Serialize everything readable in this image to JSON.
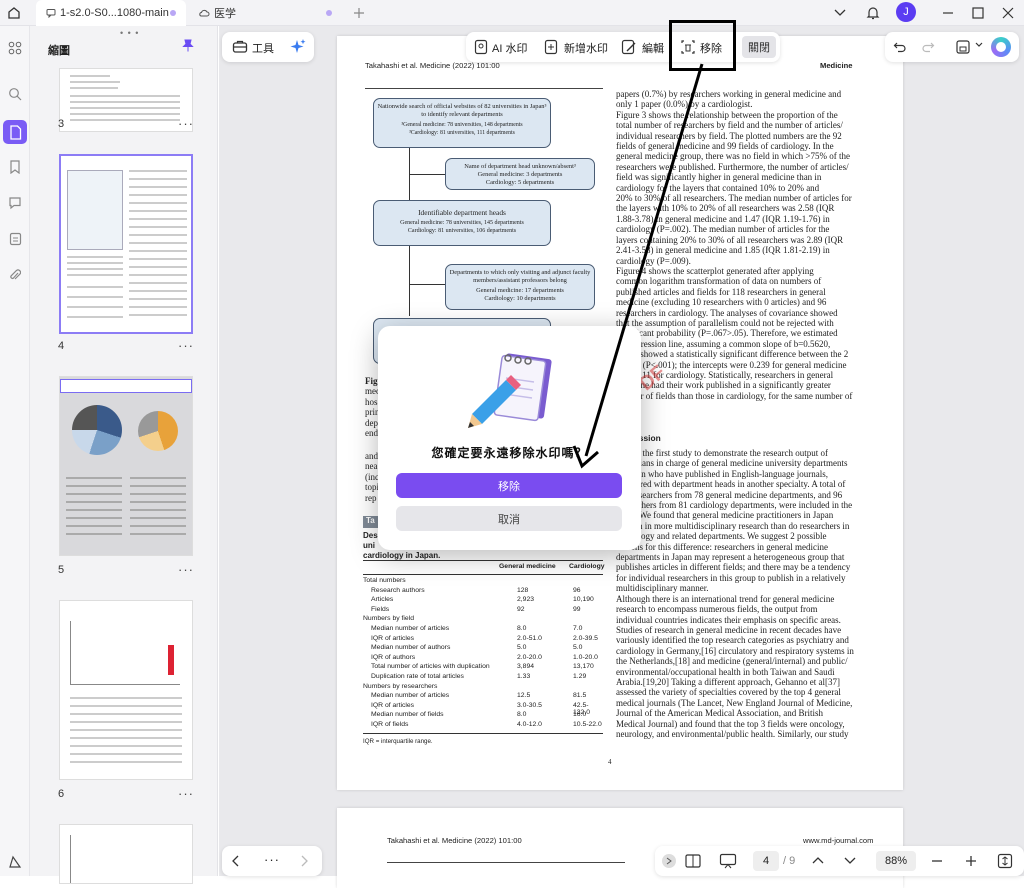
{
  "titlebar": {
    "tab1": "1-s2.0-S0...1080-main",
    "tab2": "医学",
    "avatar": "J"
  },
  "toolbar": {
    "tools_label": "工具",
    "ai_watermark": "AI 水印",
    "add_watermark": "新增水印",
    "edit": "編輯",
    "remove": "移除",
    "close": "關閉"
  },
  "sidebar": {
    "title": "縮圖",
    "pages": [
      {
        "num": "3",
        "more": "···"
      },
      {
        "num": "4",
        "more": "···"
      },
      {
        "num": "5",
        "more": "···"
      },
      {
        "num": "6",
        "more": "···"
      }
    ]
  },
  "page": {
    "running_head": "Takahashi et al. Medicine (2022) 101:00",
    "journal": "Medicine",
    "page_number": "4",
    "flow": {
      "box1": "Nationwide search of official websites of 82 universities in Japan³ to identify relevant departments",
      "box1_sub1": "³General medicine: 78 universities, 148 departments",
      "box1_sub2": "³Cardiology: 81 universities, 111 departments",
      "box2": "Name of department head unknown/absent³",
      "box2_sub1": "General medicine: 3 departments",
      "box2_sub2": "Cardiology: 5 departments",
      "box3": "Identifiable department heads",
      "box3_sub1": "General medicine: 78 universities, 145 departments",
      "box3_sub2": "Cardiology: 81 universities, 106 departments",
      "box4": "Departments to which only visiting and adjunct faculty members/assistant professors belong",
      "box4_sub1": "General medicine: 17 departments",
      "box4_sub2": "Cardiology: 10 departments"
    },
    "left_fragments": [
      "Figu",
      "med",
      "hos",
      "prin",
      "dep",
      "end"
    ],
    "left_fragments2": [
      "and",
      "nea",
      "(inc",
      "topi",
      "rep"
    ],
    "table_label": "Ta",
    "table_title1": "Des",
    "table_title2": "uni",
    "table_title3": "cardiology in Japan.",
    "table": {
      "headers": [
        "General medicine",
        "Cardiology"
      ],
      "rows": [
        [
          "Total numbers",
          "",
          ""
        ],
        [
          "Research authors",
          "128",
          "96"
        ],
        [
          "Articles",
          "2,923",
          "10,190"
        ],
        [
          "Fields",
          "92",
          "99"
        ],
        [
          "Numbers by field",
          "",
          ""
        ],
        [
          "Median number of articles",
          "8.0",
          "7.0"
        ],
        [
          "IQR of articles",
          "2.0-51.0",
          "2.0-39.5"
        ],
        [
          "Median number of authors",
          "5.0",
          "5.0"
        ],
        [
          "IQR of authors",
          "2.0-20.0",
          "1.0-20.0"
        ],
        [
          "Total number of articles with duplication",
          "3,894",
          "13,170"
        ],
        [
          "Duplication rate of total articles",
          "1.33",
          "1.29"
        ],
        [
          "Numbers by researchers",
          "",
          ""
        ],
        [
          "Median number of articles",
          "12.5",
          "81.5"
        ],
        [
          "IQR of articles",
          "3.0-30.5",
          "42.5-132.0"
        ],
        [
          "Median number of fields",
          "8.0",
          "16.0"
        ],
        [
          "IQR of fields",
          "4.0-12.0",
          "10.5-22.0"
        ]
      ],
      "footnote": "IQR = interquartile range."
    },
    "right_col": [
      "papers (0.7%) by researchers working in general medicine and",
      "only 1 paper (0.0%) by a cardiologist.",
      "Figure 3 shows the relationship between the proportion of the",
      "total number of researchers by field and the number of articles/",
      "individual researchers by field. The plotted numbers are the 92",
      "fields of general medicine and 99 fields of cardiology. In the",
      "general medicine group, there was no field in which >75% of the",
      "researchers were published. Furthermore, the number of articles/",
      "field was significantly higher in general medicine than in",
      "cardiology for the layers that contained 10% to 20% and",
      "20% to 30% of all researchers. The median number of articles for",
      "the layers with 10% to 20% of all researchers was 2.58 (IQR",
      "1.88-3.78) in general medicine and 1.47 (IQR 1.19-1.76) in",
      "cardiology (P=.002). The median number of articles for the",
      "layers containing 20% to 30% of all researchers was 2.89 (IQR",
      "2.41-3.58) in general medicine and 1.85 (IQR 1.81-2.19) in",
      "cardiology (P=.009).",
      "Figure 4 shows the scatterplot generated after applying",
      "common logarithm transformation of data on numbers of",
      "published articles and fields for 118 researchers in general",
      "medicine (excluding 10 researchers with 0 articles) and 96",
      "researchers in cardiology. The analyses of covariance showed",
      "that the assumption of parallelism could not be rejected with",
      "significant probability (P=.067>.05). Therefore, we estimated",
      "the regression line, assuming a common slope of b=0.5620,",
      "which showed a statistically significant difference between the 2",
      "groups (P<.001); the intercepts were 0.239 for general medicine",
      "and 0.111 for cardiology. Statistically, researchers in general",
      "medicine had their work published in a significantly greater",
      "number of fields than those in cardiology, for the same number of"
    ],
    "discussion_heading": "Discussion",
    "discussion": [
      "This is the first study to demonstrate the research output of",
      "physicians in charge of general medicine university departments",
      "in Japan who have published in English-language journals,",
      "compared with department heads in another specialty. A total of",
      "128 researchers from 78 general medicine departments, and 96",
      "researchers from 81 cardiology departments, were included in the",
      "study. We found that general medicine practitioners in Japan",
      "publish in more multidisciplinary research than do researchers in",
      "cardiology and related departments. We suggest 2 possible",
      "reasons for this difference: researchers in general medicine",
      "departments in Japan may represent a heterogeneous group that",
      "publishes articles in different fields; and there may be a tendency",
      "for individual researchers in this group to publish in a relatively",
      "multidisciplinary manner.",
      "Although there is an international trend for general medicine",
      "research to encompass numerous fields, the output from",
      "individual countries indicates their emphasis on specific areas.",
      "Studies of research in general medicine in recent decades have",
      "variously identified the top research categories as psychiatry and",
      "cardiology in Germany,[16] circulatory and respiratory systems in",
      "the Netherlands,[18] and medicine (general/internal) and public/",
      "environmental/occupational health in both Taiwan and Saudi",
      "Arabia.[19,20] Taking a different approach, Gehanno et al[37]",
      "assessed the variety of specialties covered by the top 4 general",
      "medical journals (The Lancet, New England Journal of Medicine,",
      "Journal of the American Medical Association, and British",
      "Medical Journal) and found that the top 3 fields were oncology,",
      "neurology, and environmental/public health. Similarly, our study"
    ]
  },
  "page2": {
    "running_head": "Takahashi et al. Medicine (2022) 101:00",
    "url": "www.md-journal.com"
  },
  "watermark": "UPDF",
  "dialog": {
    "message": "您確定要永遠移除水印嗎？",
    "confirm": "移除",
    "cancel": "取消"
  },
  "bottombar": {
    "current_page": "4",
    "total": "/ 9",
    "zoom": "88%"
  },
  "nav": {
    "more": "···"
  }
}
